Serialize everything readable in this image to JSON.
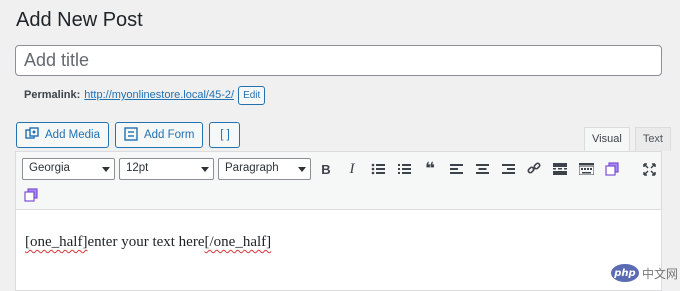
{
  "page": {
    "title": "Add New Post"
  },
  "title_input": {
    "placeholder": "Add title"
  },
  "permalink": {
    "label": "Permalink:",
    "url": "http://myonlinestore.local/45-2/",
    "edit_label": "Edit"
  },
  "media_buttons": {
    "add_media": "Add Media",
    "add_form": "Add Form",
    "shortcode": "[ ]"
  },
  "tabs": {
    "visual": "Visual",
    "text": "Text"
  },
  "toolbar": {
    "font_family": "Georgia",
    "font_size": "12pt",
    "format": "Paragraph",
    "bold": "B",
    "italic": "I"
  },
  "editor": {
    "content_open": "[one_half]",
    "content_mid": "enter your text here",
    "content_close": "[/one_half]"
  },
  "watermark": {
    "logo": "php",
    "text": "中文网"
  },
  "colors": {
    "accent": "#2271b1",
    "purple_icon": "#7b4fd1"
  }
}
